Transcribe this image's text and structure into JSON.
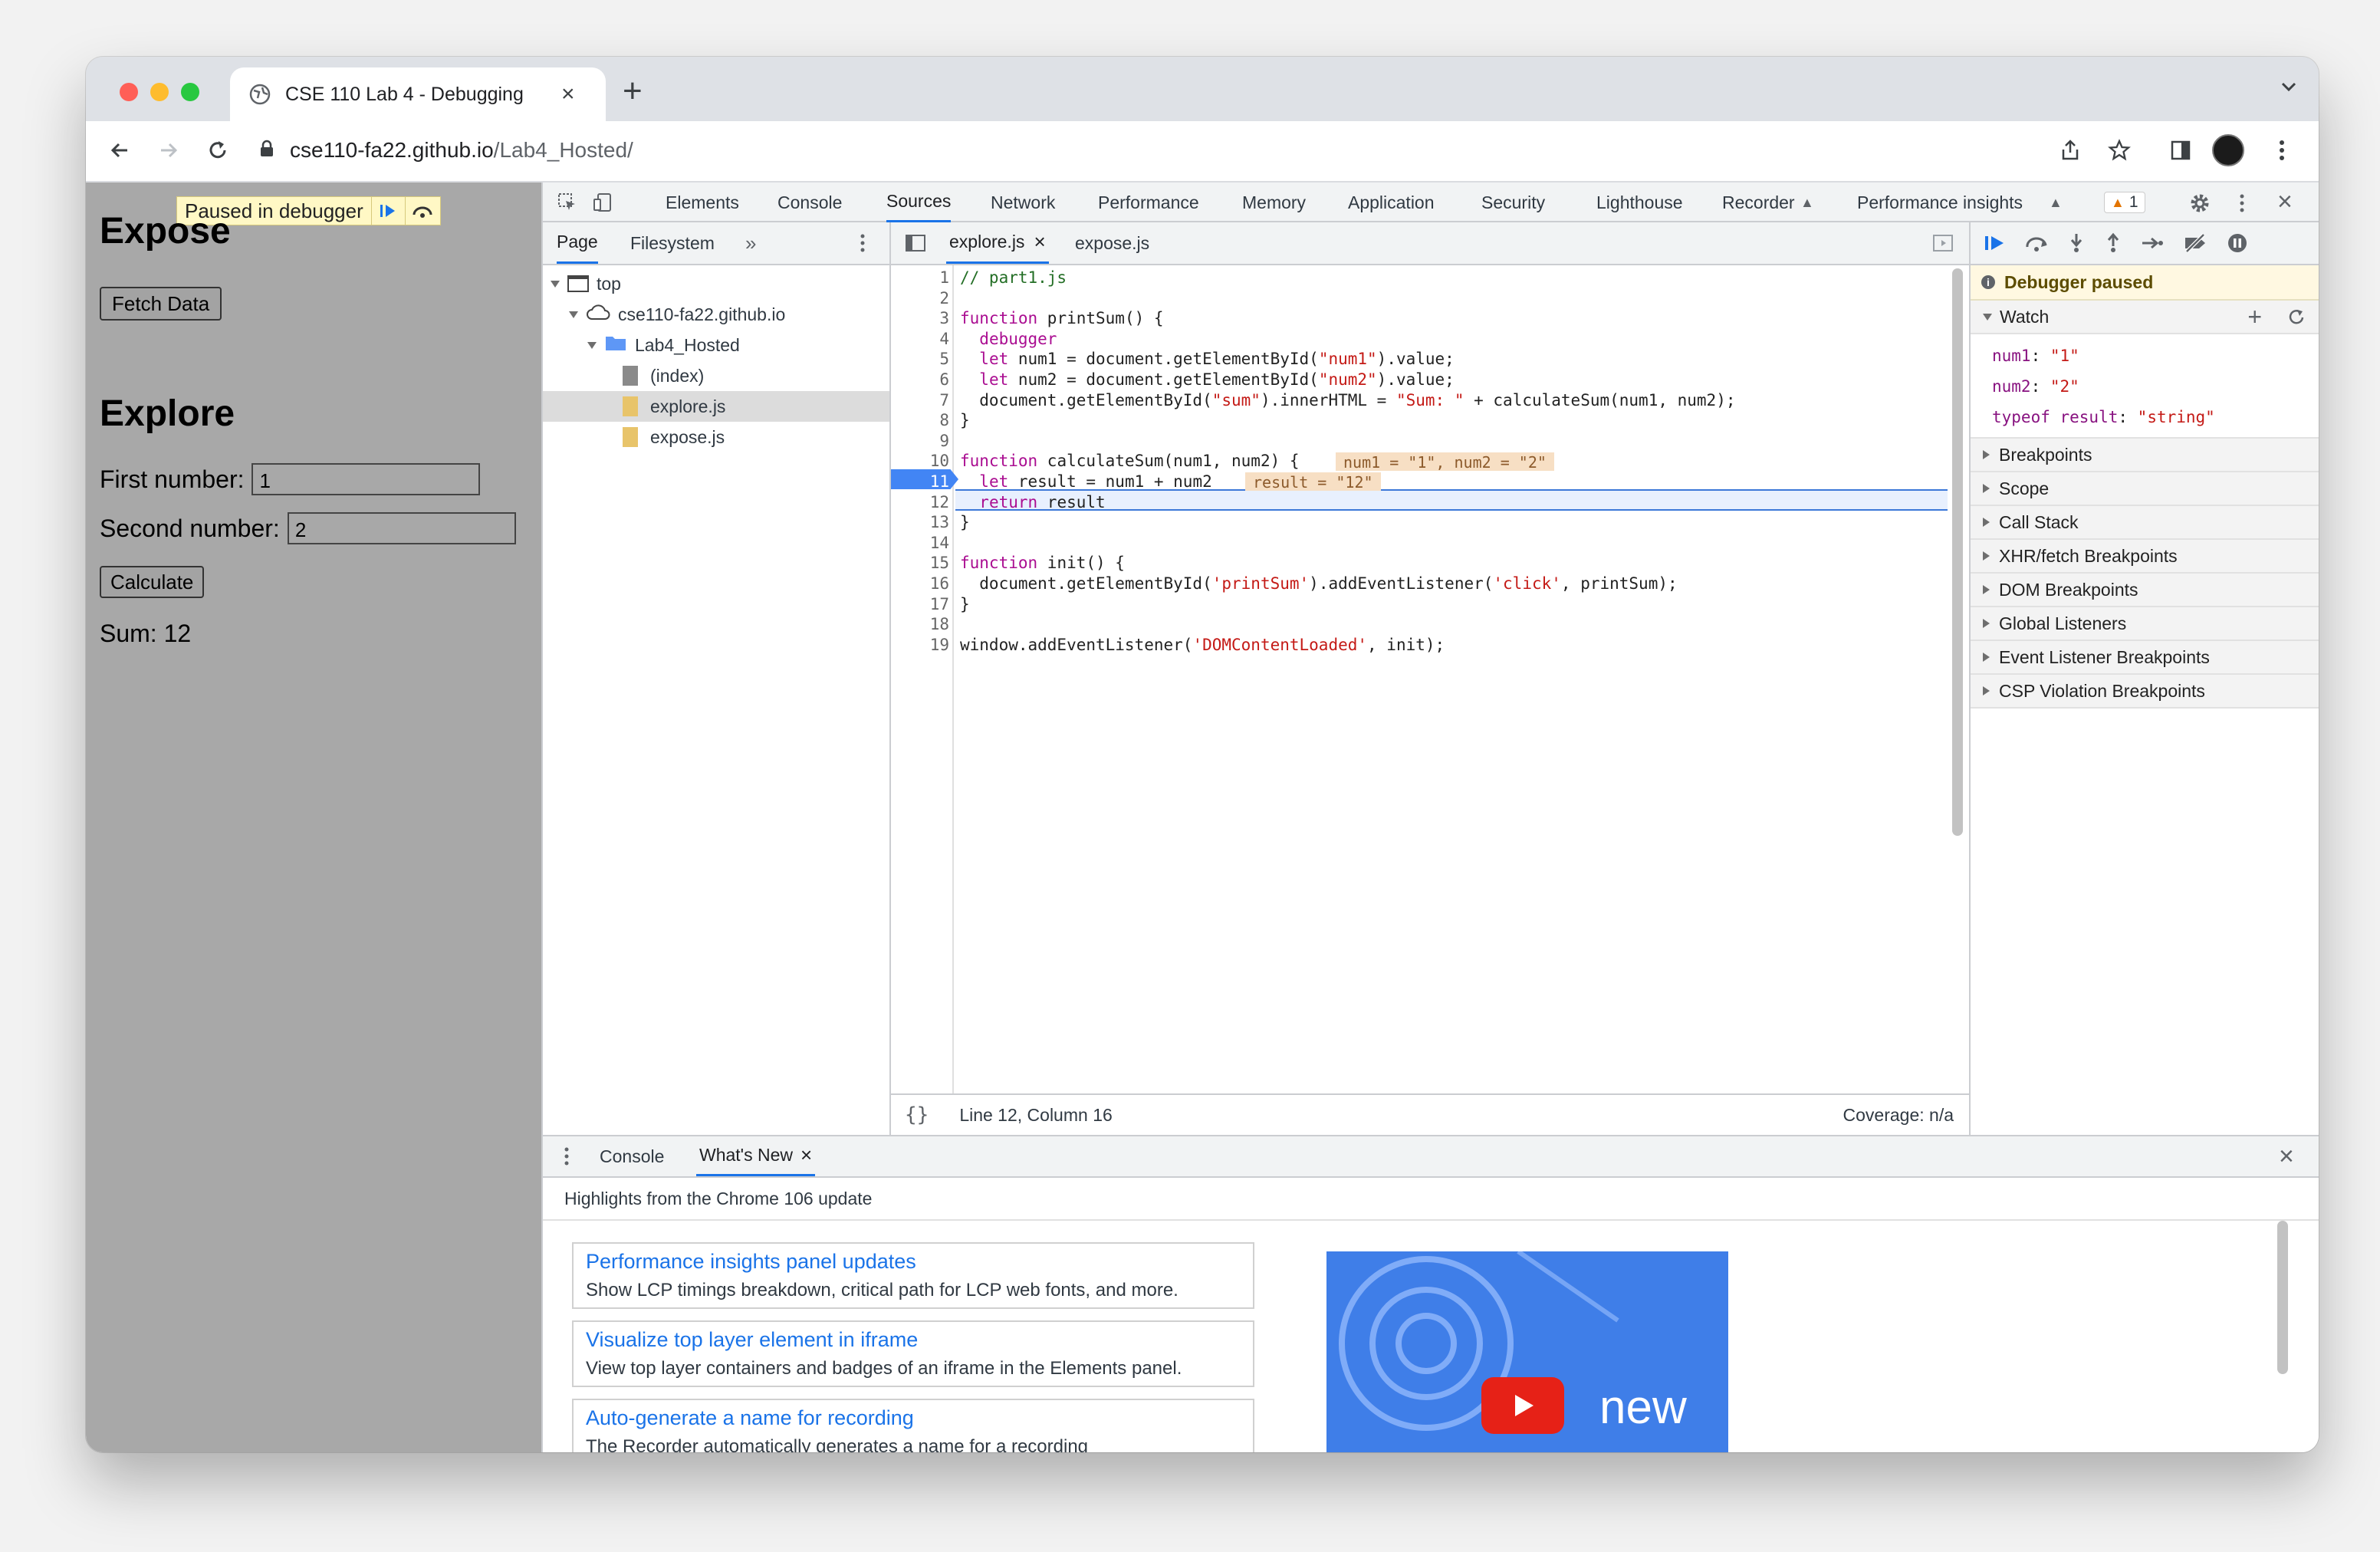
{
  "browser": {
    "tab_title": "CSE 110 Lab 4 - Debugging",
    "url_host": "cse110-fa22.github.io",
    "url_path": "/Lab4_Hosted/"
  },
  "page": {
    "paused_label": "Paused in debugger",
    "h1_top": "Expose",
    "fetch_button": "Fetch Data",
    "h2": "Explore",
    "first_label": "First number:",
    "first_value": "1",
    "second_label": "Second number:",
    "second_value": "2",
    "calc_button": "Calculate",
    "sum": "Sum: 12"
  },
  "devtools": {
    "tabs": [
      "Elements",
      "Console",
      "Sources",
      "Network",
      "Performance",
      "Memory",
      "Application",
      "Security",
      "Lighthouse",
      "Recorder",
      "Performance insights"
    ],
    "issues_count": "1",
    "nav_tabs": [
      "Page",
      "Filesystem"
    ],
    "tree": {
      "top": "top",
      "domain": "cse110-fa22.github.io",
      "folder": "Lab4_Hosted",
      "files": [
        "(index)",
        "explore.js",
        "expose.js"
      ]
    },
    "editor_tabs": [
      "explore.js",
      "expose.js"
    ],
    "code_lines": [
      "// part1.js",
      "",
      "function printSum() {",
      "  debugger",
      "  let num1 = document.getElementById(\"num1\").value;",
      "  let num2 = document.getElementById(\"num2\").value;",
      "  document.getElementById(\"sum\").innerHTML = \"Sum: \" + calculateSum(num1, num2);",
      "}",
      "",
      "function calculateSum(num1, num2) {",
      "  let result = num1 + num2",
      "  return result",
      "}",
      "",
      "function init() {",
      "  document.getElementById('printSum').addEventListener('click', printSum);",
      "}",
      "",
      "window.addEventListener('DOMContentLoaded', init);"
    ],
    "inline_values": {
      "line10": "num1 = \"1\", num2 = \"2\"",
      "line11": "result = \"12\""
    },
    "status_position": "Line 12, Column 16",
    "coverage": "Coverage: n/a",
    "debugger_paused": "Debugger paused",
    "watch_title": "Watch",
    "watch": [
      {
        "name": "num1",
        "value": "\"1\""
      },
      {
        "name": "num2",
        "value": "\"2\""
      },
      {
        "name": "typeof result",
        "value": "\"string\""
      }
    ],
    "sections": [
      "Breakpoints",
      "Scope",
      "Call Stack",
      "XHR/fetch Breakpoints",
      "DOM Breakpoints",
      "Global Listeners",
      "Event Listener Breakpoints",
      "CSP Violation Breakpoints"
    ],
    "drawer_tabs": [
      "Console",
      "What's New"
    ],
    "whats_new_header": "Highlights from the Chrome 106 update",
    "cards": [
      {
        "title": "Performance insights panel updates",
        "desc": "Show LCP timings breakdown, critical path for LCP web fonts, and more."
      },
      {
        "title": "Visualize top layer element in iframe",
        "desc": "View top layer containers and badges of an iframe in the Elements panel."
      },
      {
        "title": "Auto-generate a name for recording",
        "desc": "The Recorder automatically generates a name for a recording"
      }
    ],
    "video_text": "new"
  },
  "colors": {
    "accent": "#1a73e8",
    "paused_bg": "#fff8c5",
    "exec_line": "#e8f0fe"
  }
}
